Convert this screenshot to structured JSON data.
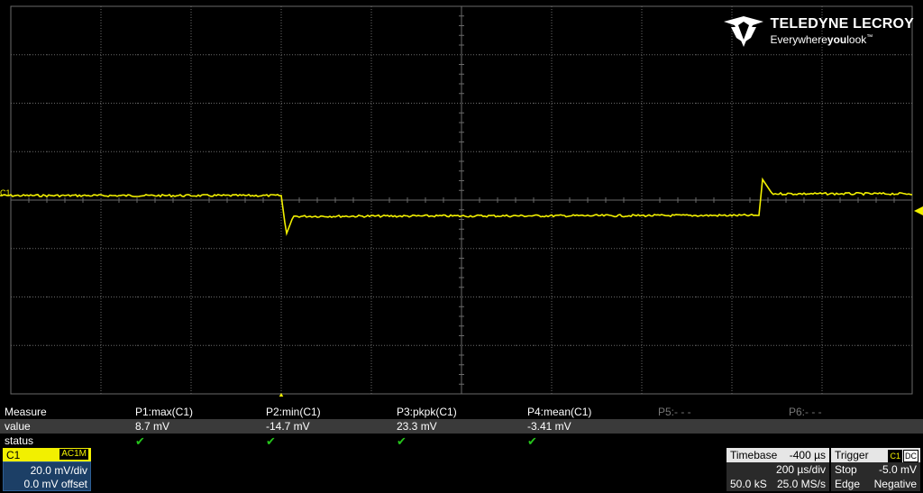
{
  "brand": {
    "name": "TELEDYNE LECROY",
    "tagline_pre": "Everywhere",
    "tagline_bold": "you",
    "tagline_post": "look",
    "tm": "™"
  },
  "trace_label": "C1",
  "colors": {
    "trace": "#f2f000",
    "grid": "#6a6a6a",
    "check": "#25c41b",
    "channel_body": "#1c3f66"
  },
  "measure": {
    "row_labels": [
      "Measure",
      "value",
      "status"
    ],
    "params": [
      {
        "name": "P1:max(C1)",
        "value": "8.7 mV",
        "status": "✔"
      },
      {
        "name": "P2:min(C1)",
        "value": "-14.7 mV",
        "status": "✔"
      },
      {
        "name": "P3:pkpk(C1)",
        "value": "23.3 mV",
        "status": "✔"
      },
      {
        "name": "P4:mean(C1)",
        "value": "-3.41 mV",
        "status": "✔"
      },
      {
        "name": "P5:- - -",
        "value": "",
        "status": ""
      },
      {
        "name": "P6:- - -",
        "value": "",
        "status": ""
      }
    ]
  },
  "channel": {
    "name": "C1",
    "coupling": "AC1M",
    "scale": "20.0 mV/div",
    "offset": "0.0 mV offset"
  },
  "timebase": {
    "label": "Timebase",
    "delay": "-400 µs",
    "scale": "200 µs/div",
    "samples": "50.0 kS",
    "rate": "25.0 MS/s"
  },
  "trigger": {
    "label": "Trigger",
    "source": "C1",
    "coupling": "DC",
    "mode": "Stop",
    "level": "-5.0 mV",
    "type": "Edge",
    "slope": "Negative"
  }
}
